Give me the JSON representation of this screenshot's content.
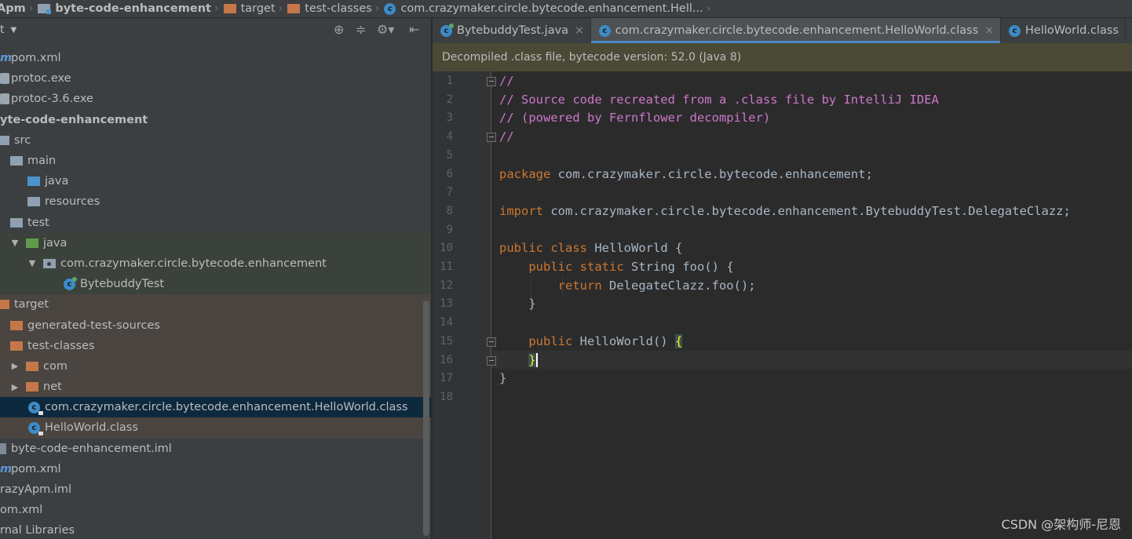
{
  "navbar": {
    "crumbs": [
      {
        "label": "Apm",
        "icon": "folder-icon",
        "bold": true
      },
      {
        "label": "byte-code-enhancement",
        "icon": "module-folder-icon",
        "bold": true
      },
      {
        "label": "target",
        "icon": "folder-icon",
        "bold": false
      },
      {
        "label": "test-classes",
        "icon": "folder-icon",
        "bold": false
      },
      {
        "label": "com.crazymaker.circle.bytecode.enhancement.Hell...",
        "icon": "class-icon",
        "bold": false
      }
    ]
  },
  "project": {
    "title": "t",
    "toolbar_icons": [
      "locate-icon",
      "collapse-all-icon",
      "settings-icon",
      "hide-panel-icon"
    ],
    "rows": [
      {
        "label": "pom.xml",
        "icon": "maven-icon"
      },
      {
        "label": "protoc.exe",
        "icon": "exe-icon"
      },
      {
        "label": "protoc-3.6.exe",
        "icon": "exe-icon"
      },
      {
        "label": "yte-code-enhancement",
        "icon": "module-icon"
      },
      {
        "label": "src",
        "icon": "folder-icon"
      },
      {
        "label": "main",
        "icon": "folder-icon"
      },
      {
        "label": "java",
        "icon": "source-folder-icon"
      },
      {
        "label": "resources",
        "icon": "resources-folder-icon"
      },
      {
        "label": "test",
        "icon": "folder-icon"
      },
      {
        "label": "java",
        "icon": "test-folder-icon"
      },
      {
        "label": "com.crazymaker.circle.bytecode.enhancement",
        "icon": "package-icon"
      },
      {
        "label": "BytebuddyTest",
        "icon": "class-icon"
      },
      {
        "label": "target",
        "icon": "folder-icon"
      },
      {
        "label": "generated-test-sources",
        "icon": "folder-icon"
      },
      {
        "label": "test-classes",
        "icon": "folder-icon"
      },
      {
        "label": "com",
        "icon": "folder-icon"
      },
      {
        "label": "net",
        "icon": "folder-icon"
      },
      {
        "label": "com.crazymaker.circle.bytecode.enhancement.HelloWorld.class",
        "icon": "class-icon"
      },
      {
        "label": "HelloWorld.class",
        "icon": "class-icon"
      },
      {
        "label": "byte-code-enhancement.iml",
        "icon": "file-icon"
      },
      {
        "label": "pom.xml",
        "icon": "maven-icon"
      },
      {
        "label": "razyApm.iml",
        "icon": "file-icon"
      },
      {
        "label": "om.xml",
        "icon": "file-icon"
      },
      {
        "label": "rnal Libraries",
        "icon": "library-icon"
      }
    ]
  },
  "tabs": [
    {
      "label": "BytebuddyTest.java",
      "close": "×",
      "active": false
    },
    {
      "label": "com.crazymaker.circle.bytecode.enhancement.HelloWorld.class",
      "close": "×",
      "active": true
    },
    {
      "label": "HelloWorld.class",
      "close": "",
      "active": false
    }
  ],
  "banner": {
    "text": "Decompiled .class file, bytecode version: 52.0 (Java 8)"
  },
  "editor": {
    "line_numbers": [
      "1",
      "2",
      "3",
      "4",
      "5",
      "6",
      "7",
      "8",
      "9",
      "10",
      "11",
      "12",
      "13",
      "14",
      "15",
      "16",
      "17",
      "18"
    ],
    "lines": [
      "//",
      "// Source code recreated from a .class file by IntelliJ IDEA",
      "// (powered by Fernflower decompiler)",
      "//",
      "",
      "package com.crazymaker.circle.bytecode.enhancement;",
      "",
      "import com.crazymaker.circle.bytecode.enhancement.BytebuddyTest.DelegateClazz;",
      "",
      "public class HelloWorld {",
      "    public static String foo() {",
      "        return DelegateClazz.foo();",
      "    }",
      "",
      "    public HelloWorld() {",
      "    }",
      "}",
      ""
    ],
    "tokens": {
      "package_kw": "package",
      "package_name": " com.crazymaker.circle.bytecode.enhancement;",
      "import_kw": "import",
      "import_name": " com.crazymaker.circle.bytecode.enhancement.BytebuddyTest.DelegateClazz;",
      "public": "public",
      "class": "class",
      "static": "static",
      "return": "return",
      "hello_decl": " HelloWorld {",
      "foo_decl": " String foo() {",
      "return_expr": " DelegateClazz.foo();",
      "close_brace": "}",
      "ctor_decl": " HelloWorld() ",
      "open_brace": "{"
    }
  },
  "watermark": "CSDN @架构师-尼恩"
}
